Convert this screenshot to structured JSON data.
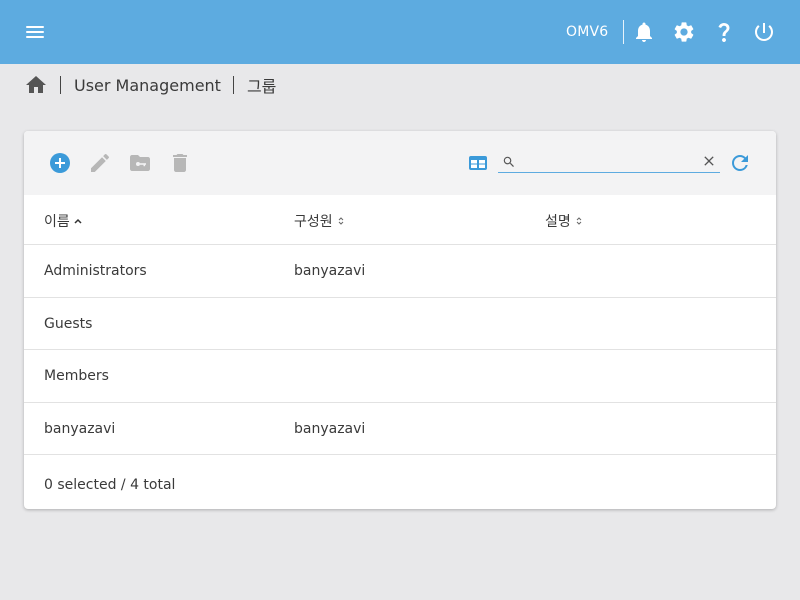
{
  "header": {
    "hostname": "OMV6",
    "icons": [
      "menu-icon",
      "bell-icon",
      "gear-icon",
      "help-icon",
      "power-icon"
    ],
    "background_color": "#5dabe0"
  },
  "breadcrumb": {
    "home_icon": "home-icon",
    "items": [
      "User Management",
      "그룹"
    ]
  },
  "toolbar": {
    "buttons": [
      "add-circle-icon",
      "pencil-icon",
      "folder-key-icon",
      "trash-icon"
    ],
    "accent_color": "#3b9ad9",
    "disabled_color": "#b7b7b7",
    "search_value": "",
    "search_placeholder": ""
  },
  "table": {
    "columns": [
      {
        "label": "이름",
        "sort": "ascending"
      },
      {
        "label": "구성원",
        "sort": "none"
      },
      {
        "label": "설명",
        "sort": "none"
      }
    ],
    "rows": [
      {
        "name": "Administrators",
        "members": "banyazavi",
        "description": ""
      },
      {
        "name": "Guests",
        "members": "",
        "description": ""
      },
      {
        "name": "Members",
        "members": "",
        "description": ""
      },
      {
        "name": "banyazavi",
        "members": "banyazavi",
        "description": ""
      }
    ],
    "footer": "0 selected / 4 total"
  }
}
